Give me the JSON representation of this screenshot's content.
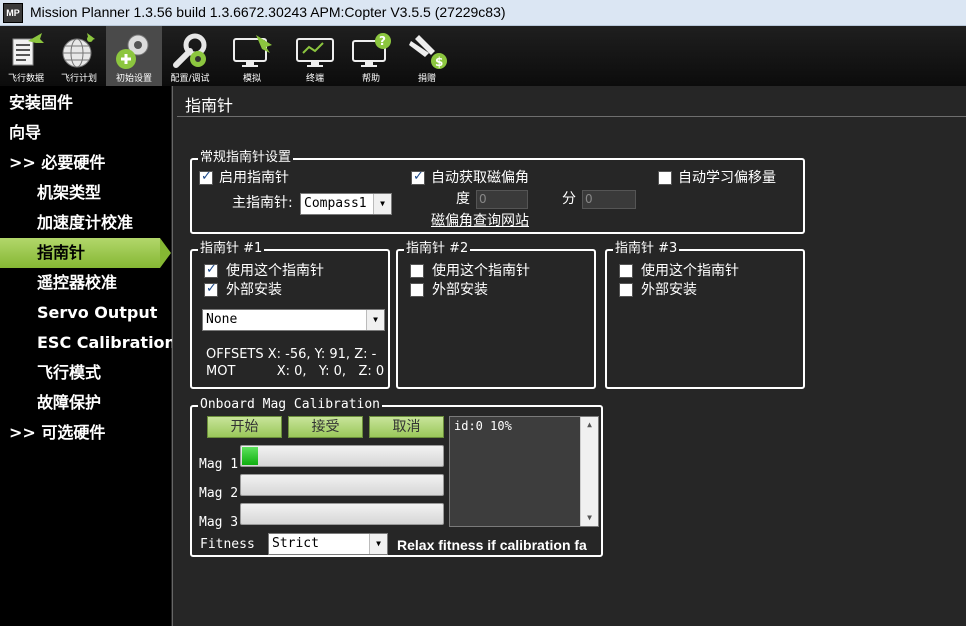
{
  "window": {
    "logo": "MP",
    "title": "Mission Planner 1.3.56 build 1.3.6672.30243 APM:Copter V3.5.5 (27229c83)"
  },
  "toolbar": {
    "items": [
      {
        "label": "飞行数据",
        "icon": "flight-data-icon"
      },
      {
        "label": "飞行计划",
        "icon": "flight-plan-icon"
      },
      {
        "label": "初始设置",
        "icon": "initial-setup-icon"
      },
      {
        "label": "配置/调试",
        "icon": "config-tuning-icon"
      },
      {
        "label": "模拟",
        "icon": "simulation-icon"
      },
      {
        "label": "终端",
        "icon": "terminal-icon"
      },
      {
        "label": "帮助",
        "icon": "help-icon"
      },
      {
        "label": "捐赠",
        "icon": "donate-icon"
      }
    ],
    "active_index": 2
  },
  "sidebar": {
    "items": [
      {
        "label": "安装固件"
      },
      {
        "label": "向导"
      },
      {
        "label": ">> 必要硬件"
      },
      {
        "label": "机架类型"
      },
      {
        "label": "加速度计校准"
      },
      {
        "label": "指南针"
      },
      {
        "label": "遥控器校准"
      },
      {
        "label": "Servo Output"
      },
      {
        "label": "ESC Calibration"
      },
      {
        "label": "飞行模式"
      },
      {
        "label": "故障保护"
      },
      {
        "label": ">> 可选硬件"
      }
    ],
    "active_index": 5
  },
  "page": {
    "title": "指南针"
  },
  "general": {
    "title": "常规指南针设置",
    "enable_compass": {
      "label": "启用指南针",
      "checked": true
    },
    "primary_label": "主指南针:",
    "primary_value": "Compass1",
    "auto_declination": {
      "label": "自动获取磁偏角",
      "checked": true
    },
    "deg_label": "度",
    "deg_value": "0",
    "min_label": "分",
    "min_value": "0",
    "declination_link": "磁偏角查询网站",
    "auto_learn": {
      "label": "自动学习偏移量",
      "checked": false
    }
  },
  "compasses": [
    {
      "title": "指南针 #1",
      "use": {
        "label": "使用这个指南针",
        "checked": true
      },
      "external": {
        "label": "外部安装",
        "checked": true
      },
      "orientation": "None",
      "offsets": "OFFSETS  X: -56,   Y: 91,   Z: -",
      "mot": "MOT          X: 0,   Y: 0,   Z: 0"
    },
    {
      "title": "指南针 #2",
      "use": {
        "label": "使用这个指南针",
        "checked": false
      },
      "external": {
        "label": "外部安装",
        "checked": false
      }
    },
    {
      "title": "指南针 #3",
      "use": {
        "label": "使用这个指南针",
        "checked": false
      },
      "external": {
        "label": "外部安装",
        "checked": false
      }
    }
  ],
  "onboard": {
    "title": "Onboard Mag Calibration",
    "start": "开始",
    "accept": "接受",
    "cancel": "取消",
    "log": "id:0 10%",
    "mag1_label": "Mag 1",
    "mag2_label": "Mag 2",
    "mag3_label": "Mag 3",
    "mag1_progress": 0.08,
    "mag2_progress": 0,
    "mag3_progress": 0,
    "fitness_label": "Fitness",
    "fitness_value": "Strict",
    "relax_note": "Relax fitness if calibration fa"
  },
  "colors": {
    "accent_green": "#85b733",
    "progress_green": "#0fae0f"
  }
}
